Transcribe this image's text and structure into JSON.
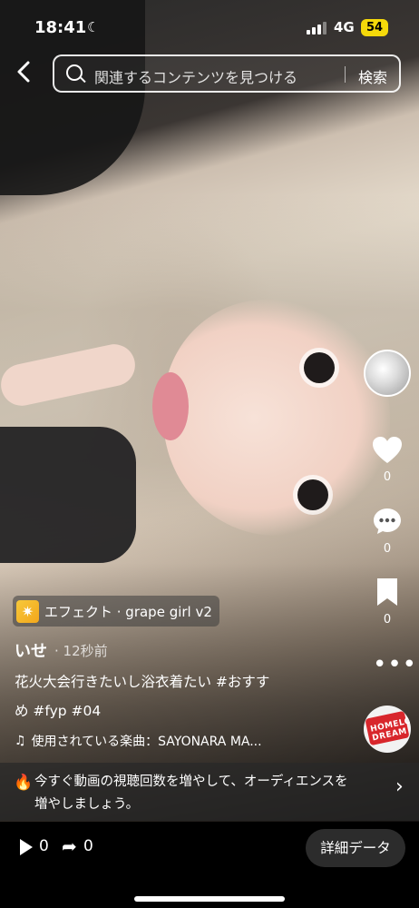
{
  "status_bar": {
    "time": "18:41",
    "network": "4G",
    "battery": "54"
  },
  "search": {
    "placeholder": "関連するコンテンツを見つける",
    "button": "検索"
  },
  "rail": {
    "likes": "0",
    "comments": "0",
    "saves": "0",
    "sound_logo_text": "HOMELON DREAM"
  },
  "video_info": {
    "effect_label": "エフェクト · grape girl v2",
    "author": "いせ",
    "posted": "· 12秒前",
    "caption_line1": "花火大会行きたいし浴衣着たい #おすす",
    "caption_line2": "め #fyp #04",
    "music": "使用されている楽曲：SAYONARA MA..."
  },
  "promo": {
    "line1": "今すぐ動画の視聴回数を増やして、オーディエンスを",
    "line2": "増やしましょう。"
  },
  "bottom_bar": {
    "plays": "0",
    "shares": "0",
    "details_button": "詳細データ"
  },
  "colors": {
    "battery": "#f5d90a",
    "effect_icon": "#f3a71c",
    "sound_logo": "#d8262c"
  }
}
